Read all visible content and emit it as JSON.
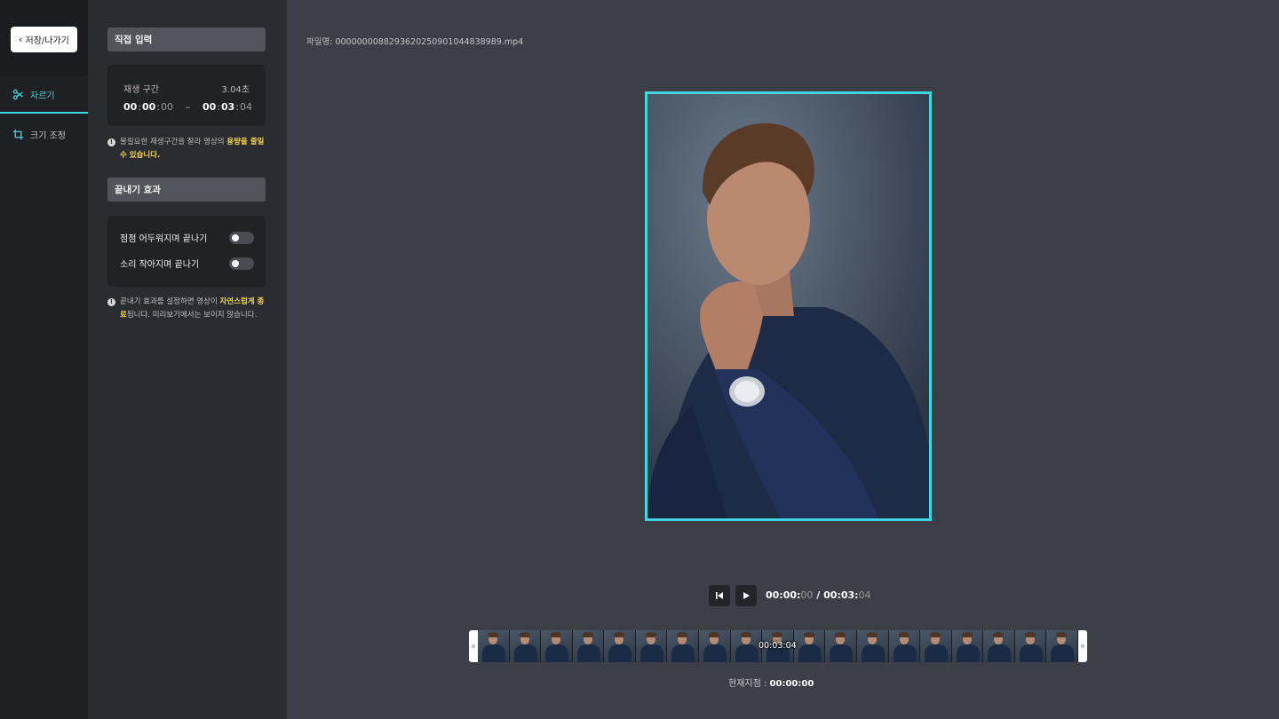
{
  "nav": {
    "save_exit": "저장/나가기",
    "items": [
      {
        "label": "자르기",
        "icon": "scissors-icon",
        "active": true
      },
      {
        "label": "크기 조정",
        "icon": "crop-icon",
        "active": false
      }
    ]
  },
  "panel": {
    "direct_input_title": "직접 입력",
    "range": {
      "label": "재생 구간",
      "duration": "3.04초",
      "start": {
        "hh": "00",
        "mm": "00",
        "ff": "00"
      },
      "end": {
        "hh": "00",
        "mm": "03",
        "ff": "04"
      }
    },
    "trim_note": {
      "prefix": "불필요한 재생구간을 잘라 영상의 ",
      "highlight": "용량을 줄일 수 있습니다."
    },
    "ending_title": "끝내기 효과",
    "effects": [
      {
        "label": "점점 어두워지며 끝나기",
        "on": false
      },
      {
        "label": "소리 작아지며 끝나기",
        "on": false
      }
    ],
    "ending_note": {
      "prefix": "끝내기 효과를 설정하면 영상이 ",
      "highlight": "자연스럽게 종료",
      "suffix": "됩니다. 미리보기에서는 보이지 않습니다."
    }
  },
  "main": {
    "filename": "파일명: 000000008829362025090104 4838989.mp4",
    "playback": {
      "current": "00:00:",
      "current_frames": "00",
      "separator": "/",
      "total": "00:03:",
      "total_frames": "04"
    },
    "timeline_label": "00:03:04",
    "current_point_label": "현재지점 :",
    "current_point_value": "00:00:00"
  },
  "colors": {
    "accent": "#3fd6e0",
    "highlight": "#f5d547"
  }
}
